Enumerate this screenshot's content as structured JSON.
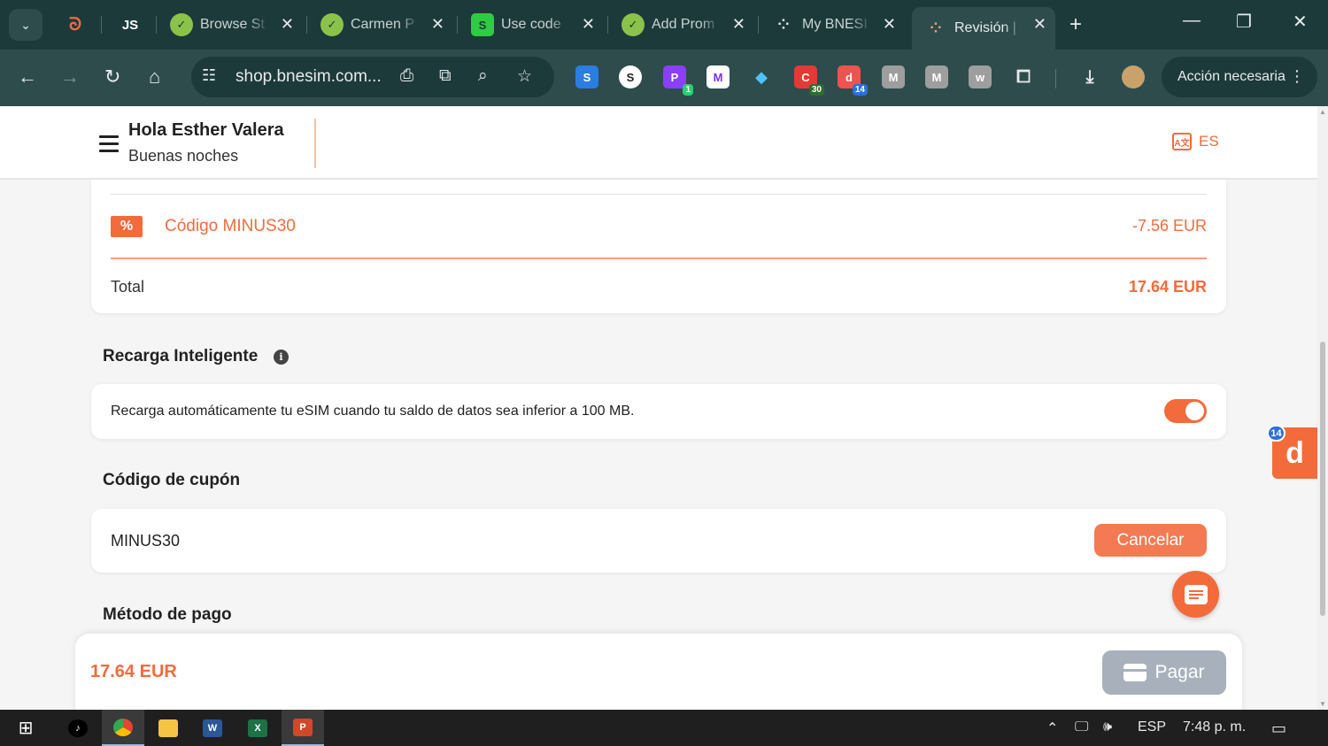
{
  "browser": {
    "tabs": [
      {
        "label": "",
        "icon": "flame-icon",
        "color": "#f36b3b"
      },
      {
        "label": "",
        "icon": "js-icon",
        "color": "#ffffff"
      },
      {
        "label": "Browse St",
        "icon": "check-leaf-icon",
        "color": "#8bc34a"
      },
      {
        "label": "Carmen P",
        "icon": "check-leaf-icon",
        "color": "#8bc34a"
      },
      {
        "label": "Use code",
        "icon": "s-green-icon",
        "color": "#2ecc40"
      },
      {
        "label": "Add Prom",
        "icon": "check-leaf-icon",
        "color": "#8bc34a"
      },
      {
        "label": "My BNESI",
        "icon": "dots-icon",
        "color": "#e8eaed"
      },
      {
        "label": "Revisión |",
        "icon": "dots-icon",
        "color": "#e8eaed",
        "active": true
      }
    ],
    "url": "shop.bnesim.com...",
    "action_pill": "Acción necesaria",
    "extension_badges": {
      "ext3": "1",
      "ext6": "30",
      "ext7": "14"
    }
  },
  "header": {
    "greeting": "Hola Esther Valera",
    "subgreeting": "Buenas noches",
    "language": "ES"
  },
  "summary": {
    "coupon_label": "Código MINUS30",
    "coupon_amount": "-7.56 EUR",
    "total_label": "Total",
    "total_amount": "17.64 EUR"
  },
  "recarga": {
    "title": "Recarga Inteligente",
    "description": "Recarga automáticamente tu eSIM cuando tu saldo de datos sea inferior a 100 MB.",
    "enabled": true
  },
  "cupon": {
    "title": "Código de cupón",
    "value": "MINUS30",
    "cancel_label": "Cancelar"
  },
  "payment": {
    "title": "Método de pago",
    "amount": "17.64 EUR",
    "pay_label": "Pagar"
  },
  "side_widget": {
    "letter": "d",
    "badge": "14"
  },
  "taskbar": {
    "language": "ESP",
    "time": "7:48 p. m."
  }
}
